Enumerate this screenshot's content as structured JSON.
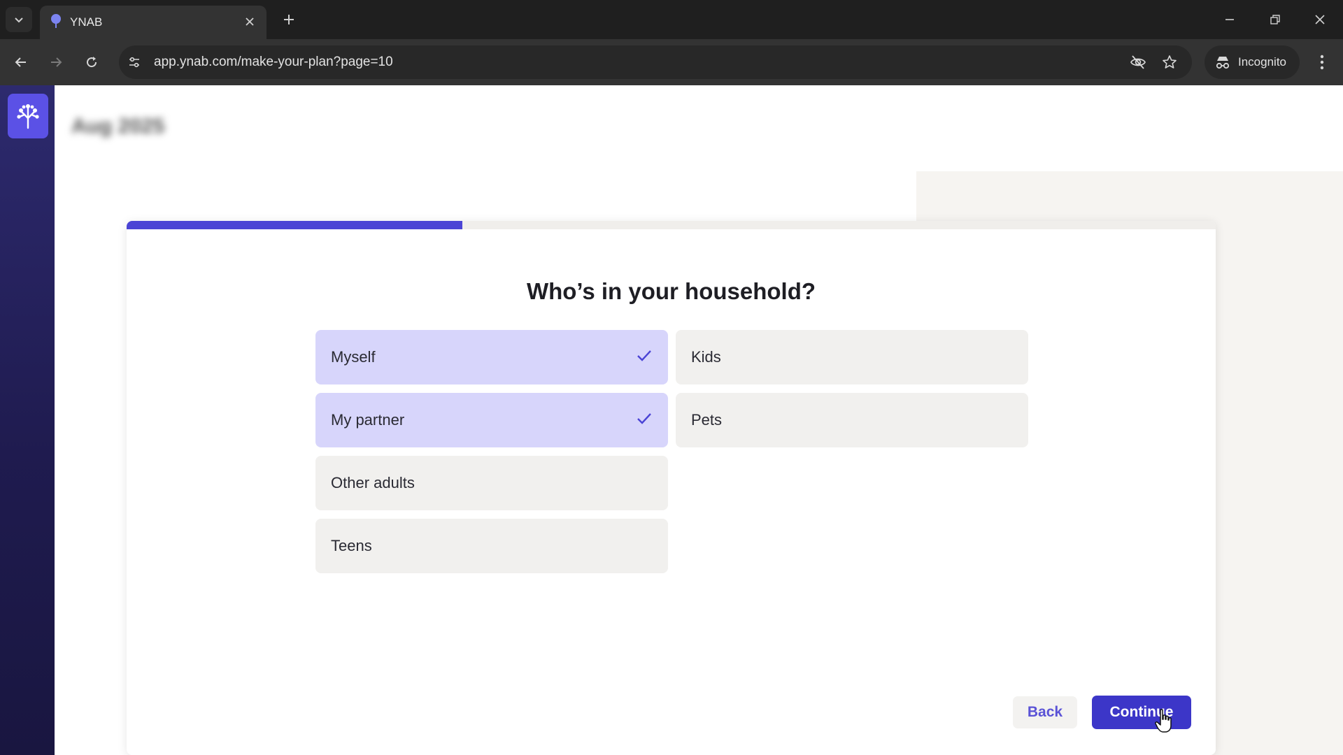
{
  "browser": {
    "tab_title": "YNAB",
    "url": "app.ynab.com/make-your-plan?page=10",
    "incognito_label": "Incognito",
    "icons": {
      "tab_menu": "chevron-down-icon",
      "favicon": "ynab-tree-icon",
      "tab_close": "close-icon",
      "new_tab": "plus-icon",
      "minimize": "minimize-icon",
      "restore": "restore-icon",
      "close_window": "close-icon",
      "back": "arrow-left-icon",
      "forward": "arrow-right-icon",
      "reload": "reload-icon",
      "site_info": "tune-icon",
      "tracking": "eye-off-icon",
      "bookmark": "star-icon",
      "incognito": "incognito-icon",
      "menu": "kebab-menu-icon"
    }
  },
  "app": {
    "month_label": "Aug 2025",
    "progress_fraction": 0.308,
    "question": "Who’s in your household?",
    "options": [
      {
        "label": "Myself",
        "selected": true
      },
      {
        "label": "Kids",
        "selected": false
      },
      {
        "label": "My partner",
        "selected": true
      },
      {
        "label": "Pets",
        "selected": false
      },
      {
        "label": "Other adults",
        "selected": false
      },
      {
        "label": "Teens",
        "selected": false
      }
    ],
    "back_label": "Back",
    "continue_label": "Continue"
  },
  "colors": {
    "accent": "#4b44d5",
    "selected_bg": "#d7d5fb",
    "option_bg": "#f1f0ee",
    "sidebar": "#1f1b4f"
  }
}
